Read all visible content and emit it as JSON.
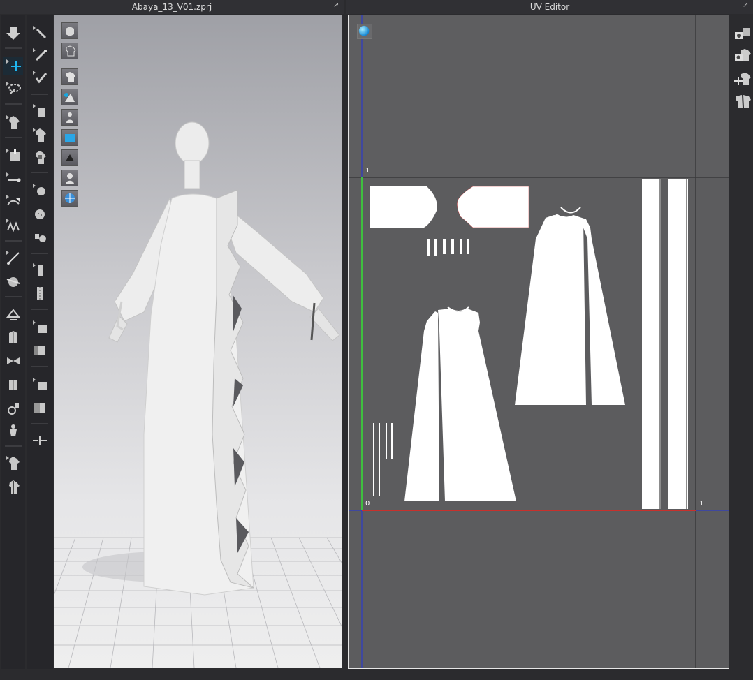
{
  "left_panel": {
    "title": "Abaya_13_V01.zprj"
  },
  "right_panel": {
    "title": "UV Editor"
  },
  "uv_editor": {
    "axis_labels": {
      "top": "1",
      "origin": "0",
      "right": "1"
    }
  },
  "colors": {
    "axis_u": "#c8302c",
    "axis_v": "#3fbf3f",
    "guide": "#2233dd",
    "accent": "#18a8e0"
  },
  "left_toolbar": [
    "down-arrow-icon",
    "move-icon",
    "lasso-icon",
    "garment-icon",
    "pin-box-icon",
    "segment-icon",
    "fold-icon",
    "pleat-icon",
    "needle-icon",
    "sphere-cut-icon",
    "fold-arrange-icon",
    "jacket-icon",
    "bow-icon",
    "box-icon",
    "person-lock-icon",
    "avatar-small-icon",
    "shirt-arrange-icon",
    "shirt-pin-icon"
  ],
  "right_toolbar": [
    "camera-texture-icon",
    "camera-shirt-icon",
    "move-shirt-icon",
    "split-shirt-icon"
  ],
  "viewport_tools": [
    "box-3d-icon",
    "shirt-outline-icon",
    "show-garment-icon",
    "show-pattern-icon",
    "show-avatar-icon",
    "show-texture-icon",
    "show-mesh-icon",
    "show-body-icon",
    "show-globe-icon"
  ]
}
